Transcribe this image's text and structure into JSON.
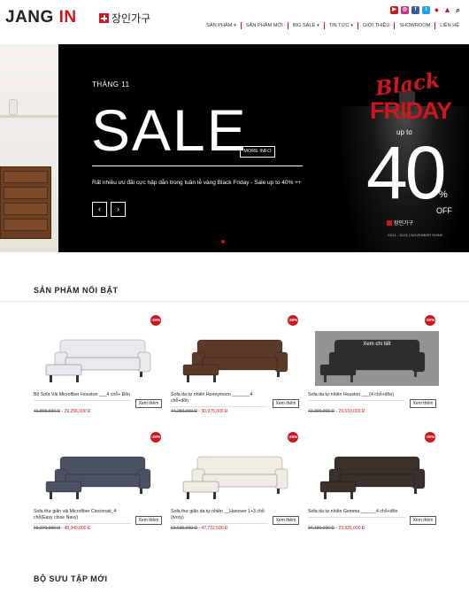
{
  "brand": {
    "name_left": "JANG ",
    "name_right": "IN",
    "korean": "장인가구"
  },
  "social_icons": [
    "youtube-icon",
    "instagram-icon",
    "facebook-icon",
    "twitter-icon",
    "user-icon",
    "cart-icon",
    "search-icon"
  ],
  "nav": {
    "items": [
      {
        "label": "SẢN PHẨM",
        "has_caret": true
      },
      {
        "label": "SẢN PHẨM MỚI",
        "has_caret": false
      },
      {
        "label": "BIG SALE",
        "has_caret": true
      },
      {
        "label": "TIN TỨC",
        "has_caret": true
      },
      {
        "label": "GIỚI THIỆU",
        "has_caret": false
      },
      {
        "label": "SHOWROOM",
        "has_caret": false
      },
      {
        "label": "LIÊN HỆ",
        "has_caret": false
      }
    ]
  },
  "hero": {
    "month": "THÁNG 11",
    "headline": "SALE",
    "more_info": "MORE INFO",
    "subtitle": "Rất nhiều ưu đãi cực hấp dẫn trong tuần lễ vàng Black Friday - Sale up to 40% ++",
    "prev": "‹",
    "next": "›",
    "promo": {
      "black": "Black",
      "friday": "FRIDAY",
      "up_to": "up to",
      "percent": "40",
      "pct_sign": "%",
      "off": "OFF",
      "korean": "장인가구",
      "date": "23/11 - 30/11 | NOVEMBER SHINE"
    }
  },
  "featured": {
    "title": "SẢN PHẨM NỔI BẬT",
    "products": [
      {
        "badge": "-30%",
        "name": "Bộ Sofa Vải Microfiber Houston ___4 chỗ+ Đôn",
        "old_price": "41,800,000 Đ",
        "new_price": "29,256,000 Đ",
        "button": "Xem thêm",
        "color": "#e9e9ee"
      },
      {
        "badge": "-30%",
        "name": "Sofa da tự nhiên Honeymoon _______4 chỗ+đôn",
        "old_price": "44,250,000 Đ",
        "new_price": "30,975,000 Đ",
        "button": "Xem thêm",
        "color": "#5a3a28"
      },
      {
        "badge": "-30%",
        "name": "Sofa da tự nhiên Houston ___(4 chỗ+đôn)",
        "old_price": "42,300,000 Đ",
        "new_price": "29,610,000 Đ",
        "button": "Xem thêm",
        "color": "#1e1e1e",
        "overlay": "Xem chi tiết"
      },
      {
        "badge": "-30%",
        "name": "Sofa thư giãn vải Microfiber Cincinnati_4 chỗ(Easy close Navy)",
        "old_price": "69,070,000 Đ",
        "new_price": "48,349,000 Đ",
        "button": "Xem thêm",
        "color": "#4c5063"
      },
      {
        "badge": "-25%",
        "name": "Sofa thư giãn da tự nhiên __Hanover 1+3 chỗ (Ivory)",
        "old_price": "63,630,000 Đ",
        "new_price": "47,722,500 Đ",
        "button": "Xem thêm",
        "color": "#f1ede6"
      },
      {
        "badge": "-30%",
        "name": "Sofa da tự nhiên Gemma ______4 chỗ+đôn",
        "old_price": "34,180,000 Đ",
        "new_price": "23,926,000 Đ",
        "button": "Xem thêm",
        "color": "#3a302c"
      }
    ]
  },
  "collection": {
    "title": "BỘ SƯU TẬP MỚI"
  }
}
